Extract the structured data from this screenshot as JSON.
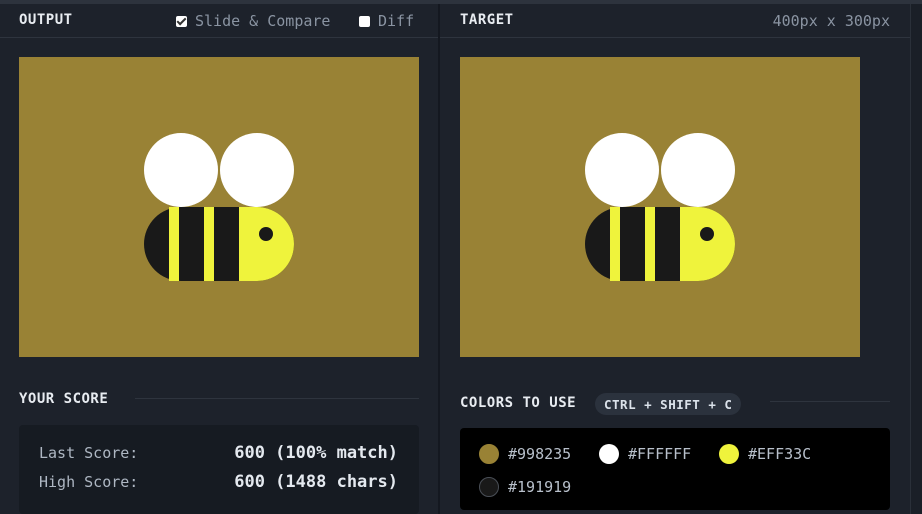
{
  "output_panel": {
    "title": "OUTPUT",
    "slide_compare": {
      "label": "Slide & Compare",
      "checked": true
    },
    "diff": {
      "label": "Diff",
      "checked": false
    }
  },
  "target_panel": {
    "title": "TARGET",
    "dimensions": "400px x 300px"
  },
  "score": {
    "title": "YOUR SCORE",
    "last_label": "Last Score:",
    "last_value": "600 (100% match)",
    "high_label": "High Score:",
    "high_value": "600 (1488 chars)"
  },
  "colors": {
    "title": "COLORS TO USE",
    "shortcut": "CTRL + SHIFT + C",
    "swatches": [
      {
        "hex": "#998235",
        "label": "#998235"
      },
      {
        "hex": "#FFFFFF",
        "label": "#FFFFFF"
      },
      {
        "hex": "#EFF33C",
        "label": "#EFF33C"
      },
      {
        "hex": "#191919",
        "label": "#191919"
      }
    ]
  },
  "theme": {
    "background": "#998235",
    "white": "#FFFFFF",
    "yellow": "#EFF33C",
    "dark": "#191919"
  }
}
